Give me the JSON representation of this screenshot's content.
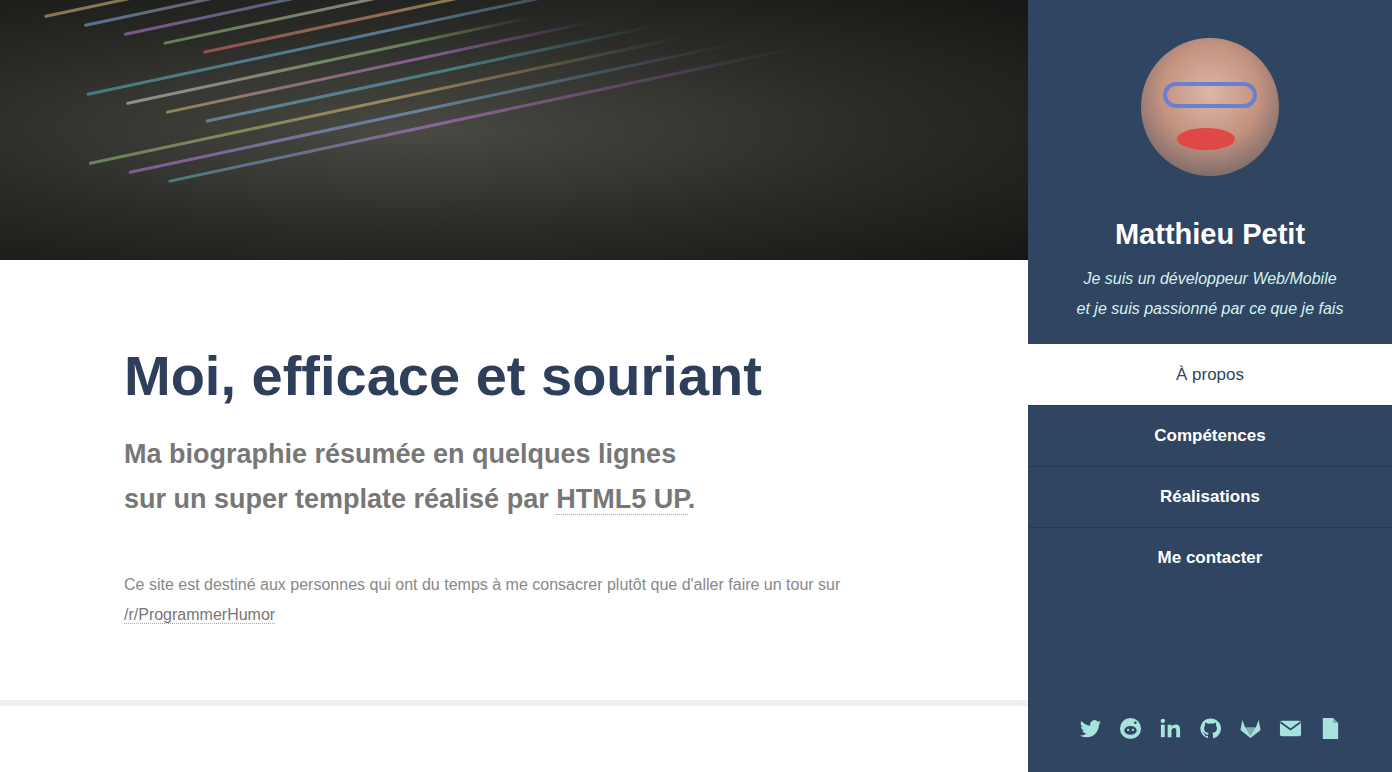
{
  "content": {
    "title": "Moi, efficace et souriant",
    "subtitle_line1": "Ma biographie résumée en quelques lignes",
    "subtitle_line2": "sur un super template réalisé par ",
    "subtitle_link": "HTML5 UP",
    "subtitle_end": ".",
    "paragraph": "Ce site est destiné aux personnes qui ont du temps à me consacrer plutôt que d'aller faire un tour sur ",
    "paragraph_link": "/r/ProgrammerHumor"
  },
  "sidebar": {
    "name": "Matthieu Petit",
    "tagline_line1": "Je suis un développeur Web/Mobile",
    "tagline_line2": "et je suis passionné par ce que je fais",
    "items": [
      {
        "label": "À propos",
        "selected": true
      },
      {
        "label": "Compétences",
        "selected": false
      },
      {
        "label": "Réalisations",
        "selected": false
      },
      {
        "label": "Me contacter",
        "selected": false
      }
    ]
  }
}
